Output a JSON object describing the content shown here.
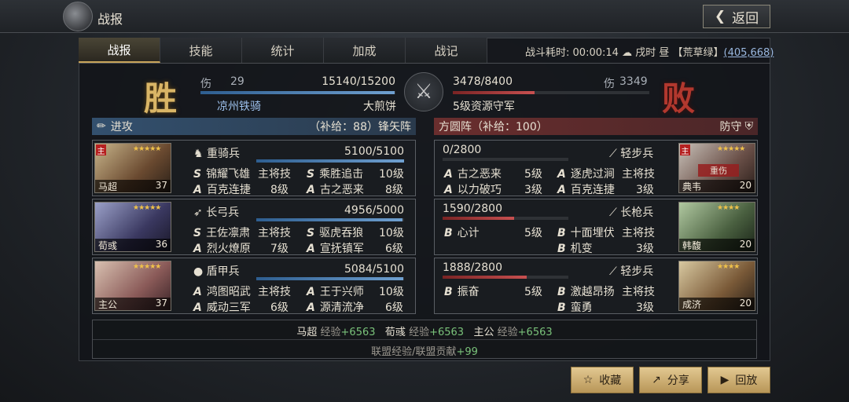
{
  "header": {
    "title": "战报",
    "back_label": "返回"
  },
  "tabs": [
    "战报",
    "技能",
    "统计",
    "加成",
    "战记"
  ],
  "battle_info": {
    "label": "战斗耗时:",
    "time": "00:00:14",
    "period": "戌时 昼",
    "region": "【荒草绿】",
    "coords": "(405,668)"
  },
  "result": {
    "win": "胜",
    "lose": "败"
  },
  "left_side": {
    "dmg_label": "伤",
    "dmg": "29",
    "troops": "15140/15200",
    "troops_cur": 15140,
    "troops_max": 15200,
    "player": "凉州铁骑",
    "item": "大煎饼"
  },
  "right_side": {
    "troops": "3478/8400",
    "troops_cur": 3478,
    "troops_max": 8400,
    "dmg_label": "伤",
    "dmg": "3349",
    "name": "5级资源守军"
  },
  "left_section": {
    "label": "进攻",
    "supply": "（补给：88）锋矢阵"
  },
  "right_section": {
    "formation": "方圆阵（补给：100）",
    "label": "防守"
  },
  "left_cards": [
    {
      "zhu": "主",
      "name": "马超",
      "level": "37",
      "troop_type": "重骑兵",
      "hp": "5100/5100",
      "hp_frac": 1.0,
      "skills": [
        [
          "S",
          "锦耀飞雄",
          "主将技"
        ],
        [
          "S",
          "乘胜追击",
          "10级"
        ],
        [
          "A",
          "百克连捷",
          "8级"
        ],
        [
          "A",
          "古之恶来",
          "8级"
        ]
      ]
    },
    {
      "zhu": "",
      "name": "荀彧",
      "level": "36",
      "troop_type": "长弓兵",
      "hp": "4956/5000",
      "hp_frac": 0.99,
      "skills": [
        [
          "S",
          "王佐凛肃",
          "主将技"
        ],
        [
          "S",
          "驱虎吞狼",
          "10级"
        ],
        [
          "A",
          "烈火燎原",
          "7级"
        ],
        [
          "A",
          "宣抚镇军",
          "6级"
        ]
      ]
    },
    {
      "zhu": "",
      "name": "主公",
      "level": "37",
      "troop_type": "盾甲兵",
      "hp": "5084/5100",
      "hp_frac": 0.997,
      "skills": [
        [
          "A",
          "鸿图昭武",
          "主将技"
        ],
        [
          "A",
          "王于兴师",
          "10级"
        ],
        [
          "A",
          "威动三军",
          "6级"
        ],
        [
          "A",
          "源清流净",
          "6级"
        ]
      ]
    }
  ],
  "right_cards": [
    {
      "zhu": "主",
      "name": "典韦",
      "level": "20",
      "status": "重伤",
      "troop_type": "轻步兵",
      "hp": "0/2800",
      "hp_frac": 0.0,
      "skills": [
        [
          "A",
          "古之恶来",
          "5级"
        ],
        [
          "A",
          "逐虎过涧",
          "主将技"
        ],
        [
          "A",
          "以力破巧",
          "3级"
        ],
        [
          "A",
          "百克连捷",
          "3级"
        ]
      ]
    },
    {
      "zhu": "",
      "name": "韩馥",
      "level": "20",
      "troop_type": "长枪兵",
      "hp": "1590/2800",
      "hp_frac": 0.57,
      "skills": [
        [
          "B",
          "心计",
          "5级"
        ],
        [
          "B",
          "十面埋伏",
          "主将技"
        ],
        [
          "",
          "",
          ""
        ],
        [
          "B",
          "机变",
          "3级"
        ]
      ]
    },
    {
      "zhu": "",
      "name": "成济",
      "level": "20",
      "troop_type": "轻步兵",
      "hp": "1888/2800",
      "hp_frac": 0.67,
      "skills": [
        [
          "B",
          "振奋",
          "5级"
        ],
        [
          "B",
          "激越昂扬",
          "主将技"
        ],
        [
          "",
          "",
          ""
        ],
        [
          "B",
          "蛮勇",
          "3级"
        ]
      ]
    }
  ],
  "exp": {
    "line1": [
      {
        "name": "马超",
        "label": "经验",
        "value": "+6563"
      },
      {
        "name": "荀彧",
        "label": "经验",
        "value": "+6563"
      },
      {
        "name": "主公",
        "label": "经验",
        "value": "+6563"
      }
    ],
    "line2_label": "联盟经验/联盟贡献",
    "line2_value": "+99"
  },
  "buttons": {
    "collect": "收藏",
    "share": "分享",
    "replay": "回放"
  }
}
